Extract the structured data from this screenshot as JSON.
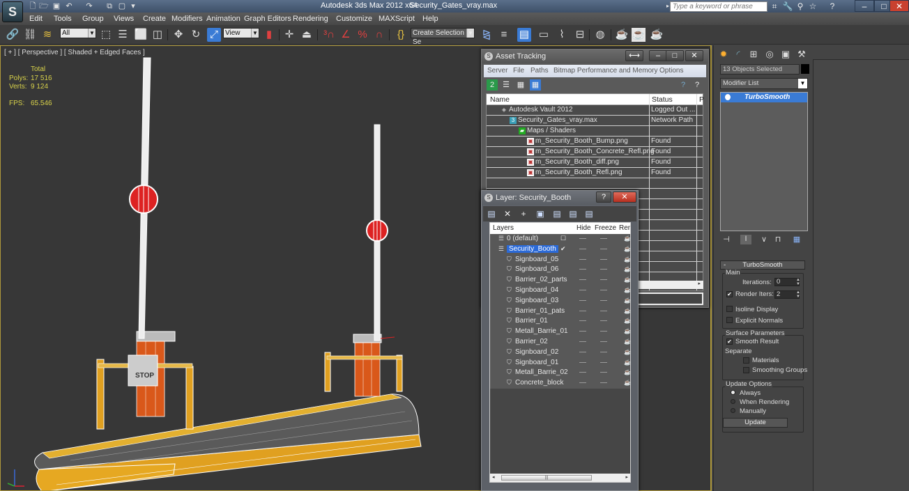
{
  "app": {
    "title": "Autodesk 3ds Max  2012 x64",
    "filename": "Security_Gates_vray.max",
    "logo": "S",
    "search_placeholder": "Type a keyword or phrase"
  },
  "menu": [
    "Edit",
    "Tools",
    "Group",
    "Views",
    "Create",
    "Modifiers",
    "Animation",
    "Graph Editors",
    "Rendering",
    "Customize",
    "MAXScript",
    "Help"
  ],
  "toolbar": {
    "selection_filter": "All",
    "reference_coord": "View",
    "named_selection": "Create Selection Se"
  },
  "viewport": {
    "label": "[ + ] [ Perspective ] [ Shaded + Edged Faces ]",
    "stats": {
      "header": "Total",
      "polys_label": "Polys:",
      "polys_value": "17 516",
      "verts_label": "Verts:",
      "verts_value": "9 124",
      "fps_label": "FPS:",
      "fps_value": "65.546"
    },
    "sign_text": "STOP"
  },
  "asset_tracking": {
    "title": "Asset Tracking",
    "menu": [
      "Server",
      "File",
      "Paths",
      "Bitmap Performance and Memory",
      "Options"
    ],
    "columns": [
      "Name",
      "Status",
      "P"
    ],
    "rows": [
      {
        "name": "Autodesk Vault 2012",
        "status": "Logged Out ...",
        "icon": "vault-icon"
      },
      {
        "name": "Security_Gates_vray.max",
        "status": "Network Path",
        "icon": "max-file-icon"
      },
      {
        "name": "Maps / Shaders",
        "status": "",
        "icon": "maps-icon"
      },
      {
        "name": "m_Security_Booth_Bump.png",
        "status": "Found",
        "icon": "image-file-icon"
      },
      {
        "name": "m_Security_Booth_Concrete_Refl.png",
        "status": "Found",
        "icon": "image-file-icon"
      },
      {
        "name": "m_Security_Booth_diff.png",
        "status": "Found",
        "icon": "image-file-icon"
      },
      {
        "name": "m_Security_Booth_Refl.png",
        "status": "Found",
        "icon": "image-file-icon"
      }
    ]
  },
  "layer_dialog": {
    "title": "Layer: Security_Booth",
    "columns": [
      "Layers",
      "Hide",
      "Freeze",
      "Ren"
    ],
    "layers": [
      {
        "name": "0 (default)",
        "level": 0,
        "type": "layer"
      },
      {
        "name": "Security_Booth",
        "level": 0,
        "type": "layer",
        "selected": true,
        "active": true
      },
      {
        "name": "Signboard_05",
        "level": 1,
        "type": "object"
      },
      {
        "name": "Signboard_06",
        "level": 1,
        "type": "object"
      },
      {
        "name": "Barrier_02_parts",
        "level": 1,
        "type": "object"
      },
      {
        "name": "Signboard_04",
        "level": 1,
        "type": "object"
      },
      {
        "name": "Signboard_03",
        "level": 1,
        "type": "object"
      },
      {
        "name": "Barrier_01_pats",
        "level": 1,
        "type": "object"
      },
      {
        "name": "Barrier_01",
        "level": 1,
        "type": "object"
      },
      {
        "name": "Metall_Barrie_01",
        "level": 1,
        "type": "object"
      },
      {
        "name": "Barrier_02",
        "level": 1,
        "type": "object"
      },
      {
        "name": "Signboard_02",
        "level": 1,
        "type": "object"
      },
      {
        "name": "Signboard_01",
        "level": 1,
        "type": "object"
      },
      {
        "name": "Metall_Barrie_02",
        "level": 1,
        "type": "object"
      },
      {
        "name": "Concrete_block",
        "level": 1,
        "type": "object"
      }
    ]
  },
  "command_panel": {
    "selection_info": "13 Objects Selected",
    "modifier_list": "Modifier List",
    "stack": [
      "TurboSmooth"
    ],
    "rollout": {
      "title": "TurboSmooth",
      "main_label": "Main",
      "iterations_label": "Iterations:",
      "iterations_value": "0",
      "render_iters_label": "Render Iters:",
      "render_iters_value": "2",
      "render_iters_checked": true,
      "isoline_label": "Isoline Display",
      "isoline_checked": false,
      "explicit_normals_label": "Explicit Normals",
      "explicit_normals_checked": false,
      "surface_label": "Surface Parameters",
      "smooth_result_label": "Smooth Result",
      "smooth_result_checked": true,
      "separate_label": "Separate",
      "materials_label": "Materials",
      "materials_checked": false,
      "smoothing_groups_label": "Smoothing Groups",
      "smoothing_groups_checked": false,
      "update_options_label": "Update Options",
      "update_options": [
        "Always",
        "When Rendering",
        "Manually"
      ],
      "update_selected": "Always",
      "update_button": "Update"
    }
  },
  "colors": {
    "selection_blue": "#3a7bd5",
    "viewport_bg": "#373737",
    "active_border": "#b09a3b",
    "stats_text": "#d8d24a"
  }
}
